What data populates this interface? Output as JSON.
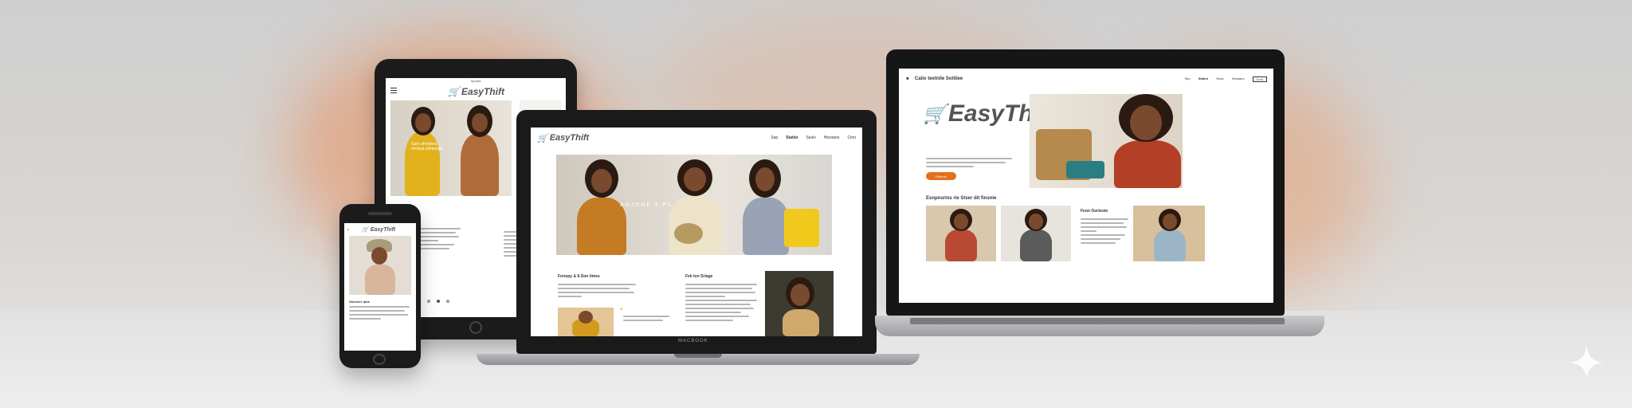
{
  "brand": {
    "name": "EasyThift",
    "accent": "#e3701e"
  },
  "tablet": {
    "status_center": "Spoeta",
    "hero_overlay": "Sare afrvidees\nehcteut stihtesiate",
    "side_heading": "et"
  },
  "phone": {
    "heading": "Stoeshrr lpha"
  },
  "laptop_center": {
    "nav_links": [
      "Sep",
      "Statist",
      "Sesiv",
      "Hiostano",
      "Cmo"
    ],
    "hero_overlay": "AUJDHE 6 PL",
    "section_left_title": "Fonopy & 6-Son times",
    "section_mid_title": "Fek ton Sriage",
    "base_brand": "MACBOOK"
  },
  "laptop_right": {
    "nav_title": "Calio textnile Soitliee",
    "nav_links": [
      "Sep",
      "Statist",
      "Sesiv",
      "Hiostano",
      "Cmo"
    ],
    "hero_button": "Ehnitutt",
    "section_title": "Esnpnsrins rie Stser dit finsnie",
    "side_title": "Feon Ourteote"
  }
}
